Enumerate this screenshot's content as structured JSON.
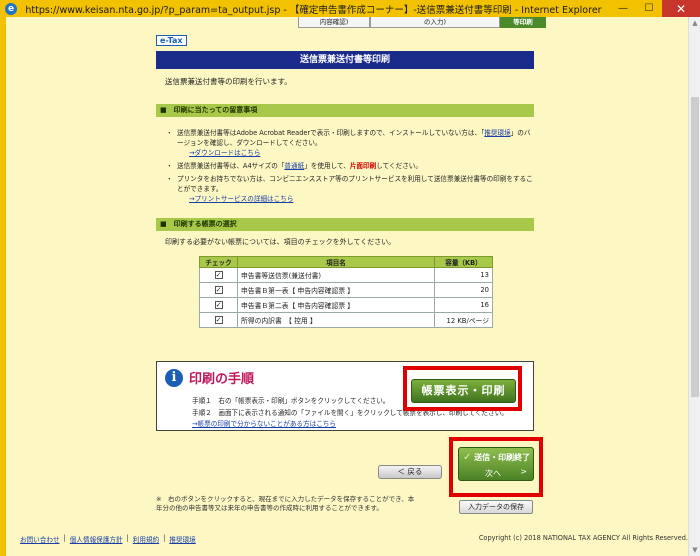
{
  "window": {
    "title": "https://www.keisan.nta.go.jp/?p_param=ta_output.jsp - 【確定申告書作成コーナー】-送信票兼送付書等印刷 - Internet Explorer",
    "minimize": "—",
    "maximize": "☐",
    "close": "✕"
  },
  "steps": {
    "tabs": [
      {
        "label": "内容確認)"
      },
      {
        "label": "の入力)"
      },
      {
        "label": "等印刷"
      }
    ]
  },
  "header": {
    "logo": "e-Tax",
    "page_title": "送信票兼送付書等印刷",
    "intro": "送信票兼送付書等の印刷を行います。"
  },
  "notes_section": {
    "heading": "■　印刷に当たっての留意事項",
    "n1_text": "送信票兼送付書等はAdobe Acrobat Readerで表示・印刷しますので、インストールしていない方は、「",
    "n1_link": "推奨環境",
    "n1_tail": "」のバージョンを確認し、ダウンロードしてください。",
    "n1_download": "→ダウンロードはこちら",
    "n2_pre": "送信票兼送付書等は、A4サイズの「",
    "n2_link": "普通紙",
    "n2_mid": "」を使用して、",
    "n2_red": "片面印刷",
    "n2_post": "してください。",
    "n3_text": "プリンタをお持ちでない方は、コンビニエンスストア等のプリントサービスを利用して送信票兼送付書等の印刷をすることができます。",
    "n3_link": "→プリントサービスの詳細はこちら"
  },
  "forms_section": {
    "heading": "■　印刷する帳票の選択",
    "intro": "印刷する必要がない帳票については、項目のチェックを外してください。",
    "columns": {
      "check": "チェック",
      "item": "項目名",
      "size": "容量（KB）"
    },
    "rows": [
      {
        "checked": "✓",
        "item": "申告書等送信票(兼送付書)",
        "size": "13"
      },
      {
        "checked": "✓",
        "item": "申告書Ｂ第一表【 申告内容確認票 】",
        "size": "20"
      },
      {
        "checked": "✓",
        "item": "申告書Ｂ第二表【 申告内容確認票 】",
        "size": "16"
      },
      {
        "checked": "✓",
        "item": "所得の内訳書　【 控用 】",
        "size": "12 KB/ページ"
      }
    ]
  },
  "procedure": {
    "icon": "i",
    "title": "印刷の手順",
    "step1": "手順１　右の「帳票表示・印刷」ボタンをクリックしてください。",
    "step2": "手順２　画面下に表示される通知の「ファイルを開く」をクリックして帳票を表示し、印刷してください。",
    "help_link": "→帳票の印刷で分からないことがある方はこちら",
    "print_button": "帳票表示・印刷"
  },
  "nav": {
    "finish_label": "送信・印刷終了",
    "finish_check": "✓",
    "next_label": "次へ",
    "next_arrow": ">",
    "back_label": "＜ 戻る",
    "save_label": "入力データの保存"
  },
  "bottom_note": "※　右のボタンをクリックすると、現在までに入力したデータを保存することができ、本年分の他の申告書等又は来年の申告書等の作成時に利用することができます。",
  "footer": {
    "links": [
      "お問い合わせ",
      "個人情報保護方針",
      "利用規約",
      "推奨環境"
    ],
    "copyright": "Copyright (c) 2018 NATIONAL TAX AGENCY All Rights Reserved."
  }
}
